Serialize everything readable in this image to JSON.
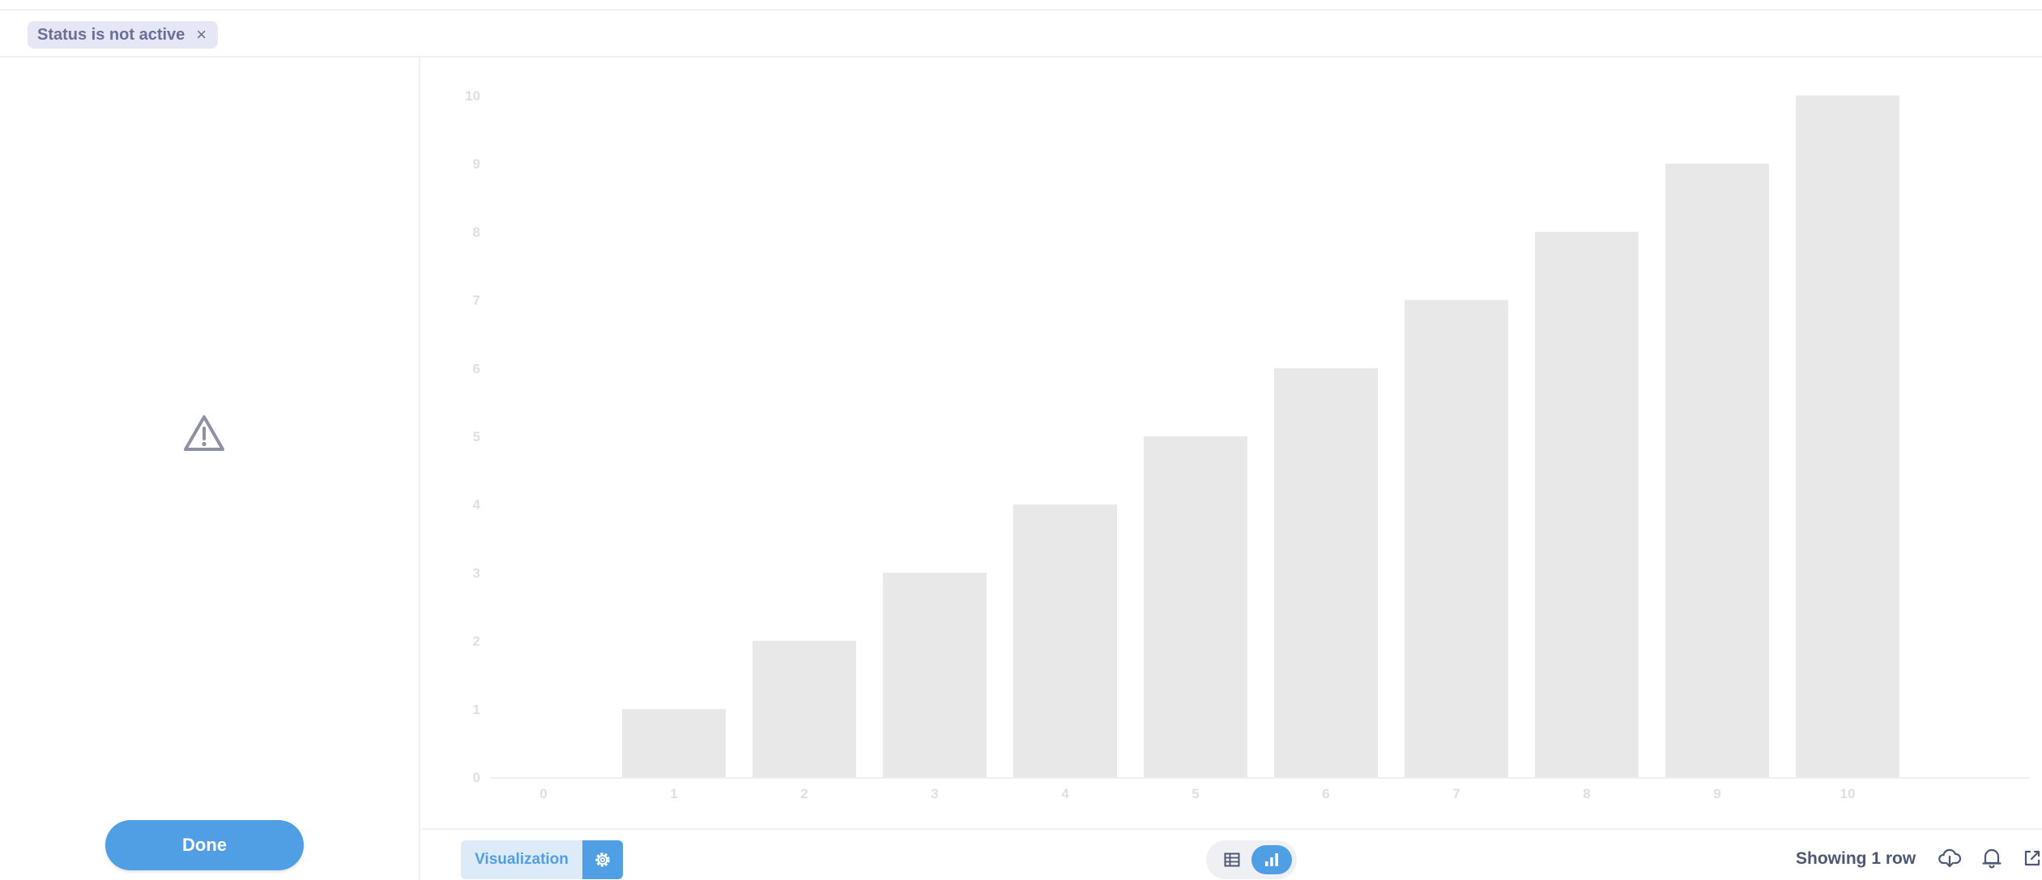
{
  "filter": {
    "label": "Status is not active",
    "remove_label": "×"
  },
  "sidebar": {
    "icon": "warning-icon",
    "done_label": "Done"
  },
  "footer": {
    "visualization_label": "Visualization",
    "settings_icon": "gear-icon",
    "toggle": {
      "table_icon": "table-icon",
      "chart_icon": "bar-chart-icon",
      "active": "chart"
    },
    "row_count": "Showing 1 row",
    "icons": [
      "download-icon",
      "bell-icon",
      "external-link-icon"
    ],
    "accent": "#509ee3"
  },
  "chart_data": {
    "type": "bar",
    "categories": [
      "0",
      "1",
      "2",
      "3",
      "4",
      "5",
      "6",
      "7",
      "8",
      "9",
      "10"
    ],
    "values": [
      0,
      1,
      2,
      3,
      4,
      5,
      6,
      7,
      8,
      9,
      10
    ],
    "y_ticks": [
      "0",
      "1",
      "2",
      "3",
      "4",
      "5",
      "6",
      "7",
      "8",
      "9",
      "10"
    ],
    "ylim": [
      0,
      10
    ],
    "grid": false,
    "bar_color": "#e8e8e8",
    "tick_color": "#dcdfe3"
  }
}
